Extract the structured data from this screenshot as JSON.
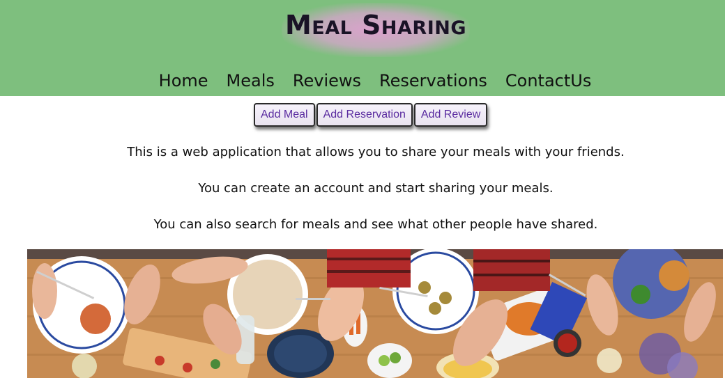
{
  "header": {
    "title": "Meal Sharing",
    "nav": [
      "Home",
      "Meals",
      "Reviews",
      "Reservations",
      "ContactUs"
    ]
  },
  "actions": [
    "Add Meal",
    "Add Reservation",
    "Add Review"
  ],
  "intro": [
    "This is a web application that allows you to share your meals with your friends.",
    "You can create an account and start sharing your meals.",
    "You can also search for meals and see what other people have shared."
  ],
  "colors": {
    "header_bg": "#7ebf7e",
    "title_glow": "#e0a0d2",
    "button_text": "#5a2ca0"
  }
}
